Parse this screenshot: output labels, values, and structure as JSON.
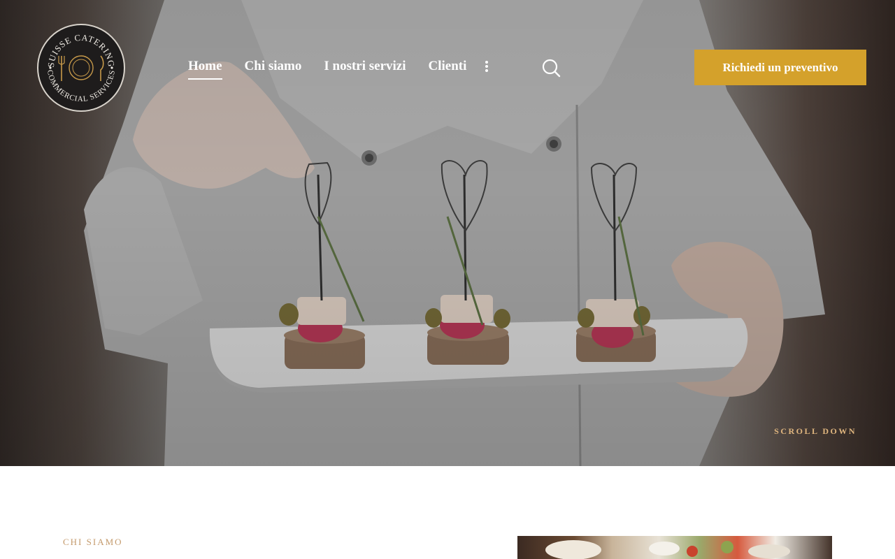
{
  "logo": {
    "top_text": "SUISSE CATERING",
    "bottom_text": "COMMERCIAL SERVICES",
    "icon": "plate-fork-knife-icon"
  },
  "nav": {
    "items": [
      {
        "label": "Home",
        "active": true
      },
      {
        "label": "Chi siamo",
        "active": false
      },
      {
        "label": "I nostri servizi",
        "active": false
      },
      {
        "label": "Clienti",
        "active": false
      }
    ],
    "more_icon": "vertical-dots-icon",
    "search_icon": "search-icon"
  },
  "cta": {
    "label": "Richiedi un preventivo"
  },
  "hero": {
    "scroll_label": "SCROLL DOWN"
  },
  "about": {
    "section_label": "CHI SIAMO"
  },
  "colors": {
    "accent": "#d4a12b",
    "scroll_text": "#e0b67f",
    "section_label": "#c49a6c"
  }
}
